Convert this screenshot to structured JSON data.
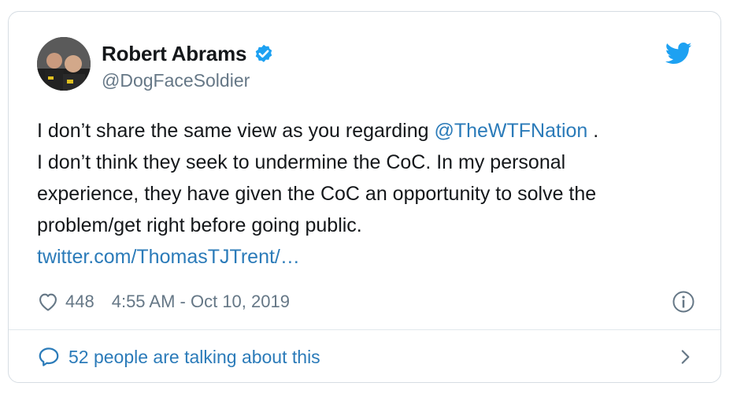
{
  "author": {
    "display_name": "Robert Abrams",
    "handle": "@DogFaceSoldier",
    "verified": true
  },
  "tweet": {
    "line1_prefix": "I don’t share the same view as you regarding ",
    "mention": "@TheWTFNation",
    "line1_suffix": " .",
    "line2": "I don’t think they seek to undermine the CoC.  In my personal",
    "line3": "experience, they have given the CoC an opportunity to solve the",
    "line4": "problem/get right before going public.",
    "link": "twitter.com/ThomasTJTrent/…"
  },
  "meta": {
    "likes": "448",
    "timestamp": "4:55 AM - Oct 10, 2019"
  },
  "footer": {
    "talking": "52 people are talking about this"
  },
  "colors": {
    "link": "#2b7bb9",
    "verified": "#1da1f2",
    "muted": "#657786"
  },
  "icons": {
    "brand": "twitter-bird-icon",
    "like": "heart-icon",
    "info": "info-icon",
    "reply": "speech-bubble-icon",
    "more": "chevron-right-icon"
  }
}
